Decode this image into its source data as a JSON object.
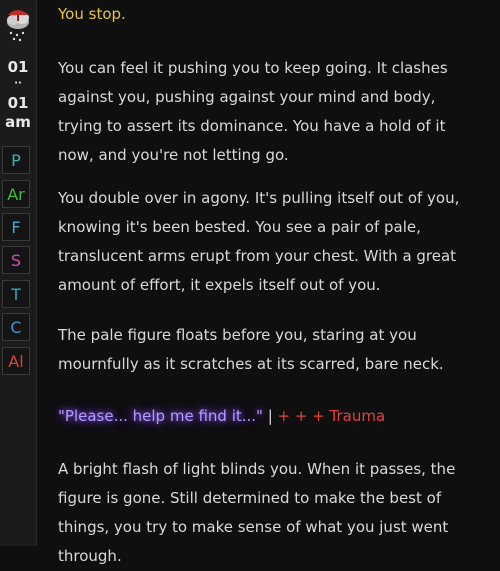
{
  "sidebar": {
    "time": {
      "hour": "01",
      "separator": "··",
      "minute": "01",
      "period": "am"
    },
    "stats": [
      {
        "label": "P",
        "color": "#37b7a5"
      },
      {
        "label": "Ar",
        "color": "#43b843"
      },
      {
        "label": "F",
        "color": "#4ea6d9"
      },
      {
        "label": "S",
        "color": "#d24fb3"
      },
      {
        "label": "T",
        "color": "#2ea6b9"
      },
      {
        "label": "C",
        "color": "#3c97c8"
      },
      {
        "label": "Al",
        "color": "#d6443c"
      }
    ]
  },
  "story": {
    "line1": "You stop.",
    "para2": "You can feel it pushing you to keep going. It clashes against you, pushing against your mind and body, trying to assert its dominance. You have a hold of it now, and you're not letting go.",
    "para3": "You double over in agony. It's pulling itself out of you, knowing it's been bested. You see a pair of pale, translucent arms erupt from your chest. With a great amount of effort, it expels itself out of you.",
    "para4": "The pale figure floats before you, staring at you mournfully as it scratches at its scarred, bare neck.",
    "speech": "\"Please... help me find it...\"",
    "divider": " | ",
    "effect": "+ + + Trauma",
    "para5": "A bright flash of light blinds you. When it passes, the figure is gone. Still determined to make the best of things, you try to make sense of what you just went through."
  }
}
